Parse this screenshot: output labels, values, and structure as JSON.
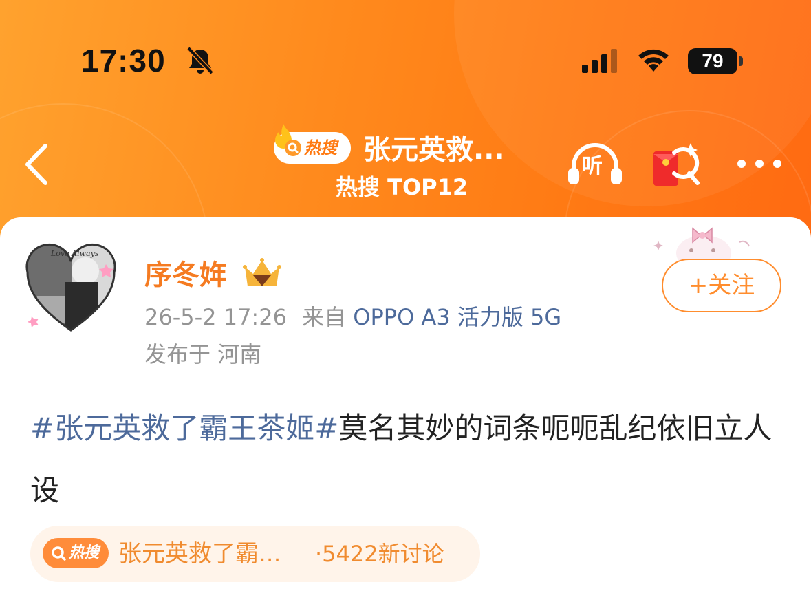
{
  "status_bar": {
    "time": "17:30",
    "battery": "79",
    "icons": [
      "bell-muted-icon",
      "cellular-signal-icon",
      "wifi-icon",
      "battery-icon"
    ]
  },
  "nav": {
    "hot_badge_label": "热搜",
    "title": "张元英救...",
    "subtitle": "热搜 TOP12",
    "listen_label": "听",
    "icons": [
      "back-arrow-icon",
      "headphones-listen-icon",
      "red-envelope-search-icon",
      "more-icon"
    ]
  },
  "post": {
    "username": "序冬姩",
    "timestamp": "26-5-2 17:26",
    "from_prefix": "来自",
    "device": "OPPO A3 活力版 5G",
    "location": "发布于 河南",
    "follow_label": "+关注",
    "topic": "#张元英救了霸王茶姬#",
    "body": "莫名其妙的词条呃呃乱纪依旧立人设"
  },
  "hot_chip": {
    "badge_label": "热搜",
    "title": "张元英救了霸...",
    "count": "·5422新讨论"
  },
  "colors": {
    "header_orange": "#ff7a14",
    "username_orange": "#f57b21",
    "link_blue": "#4d6a9b",
    "meta_gray": "#949494",
    "chip_bg": "#fff4ea"
  }
}
